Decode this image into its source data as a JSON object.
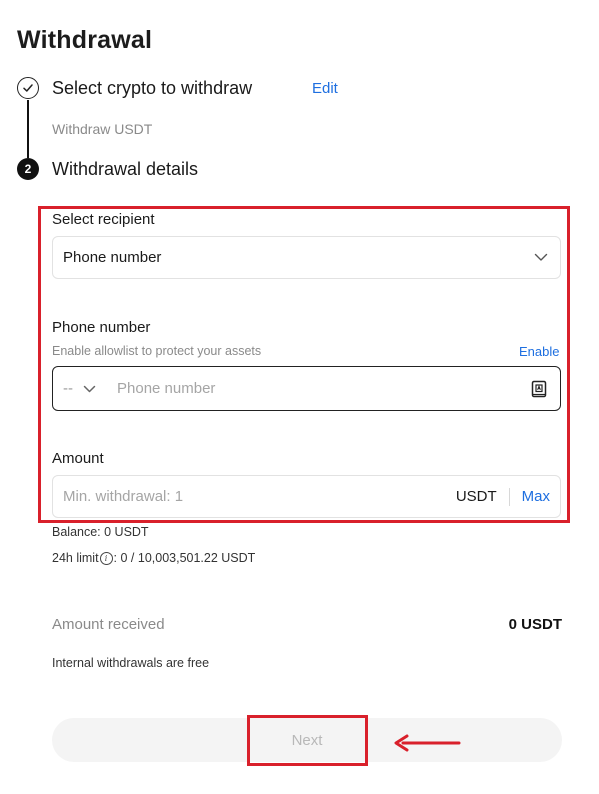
{
  "page": {
    "title": "Withdrawal"
  },
  "steps": [
    {
      "number": "",
      "title": "Select crypto to withdraw",
      "action": "Edit",
      "summary": "Withdraw USDT"
    },
    {
      "number": "2",
      "title": "Withdrawal details"
    }
  ],
  "recipient": {
    "label": "Select recipient",
    "selected": "Phone number"
  },
  "phone": {
    "label": "Phone number",
    "hint": "Enable allowlist to protect your assets",
    "enable_label": "Enable",
    "country_code": "--",
    "placeholder": "Phone number",
    "value": ""
  },
  "amount": {
    "label": "Amount",
    "placeholder": "Min. withdrawal: 1",
    "value": "",
    "unit": "USDT",
    "max_label": "Max"
  },
  "balance": {
    "text": "Balance: 0 USDT"
  },
  "limit": {
    "prefix": "24h limit",
    "text": ": 0 / 10,003,501.22 USDT"
  },
  "received": {
    "label": "Amount received",
    "value": "0 USDT"
  },
  "note": "Internal withdrawals are free",
  "next_label": "Next",
  "colors": {
    "accent": "#1e6fe0",
    "highlight": "#d9202b",
    "disabled_text": "#b8b8b8"
  }
}
